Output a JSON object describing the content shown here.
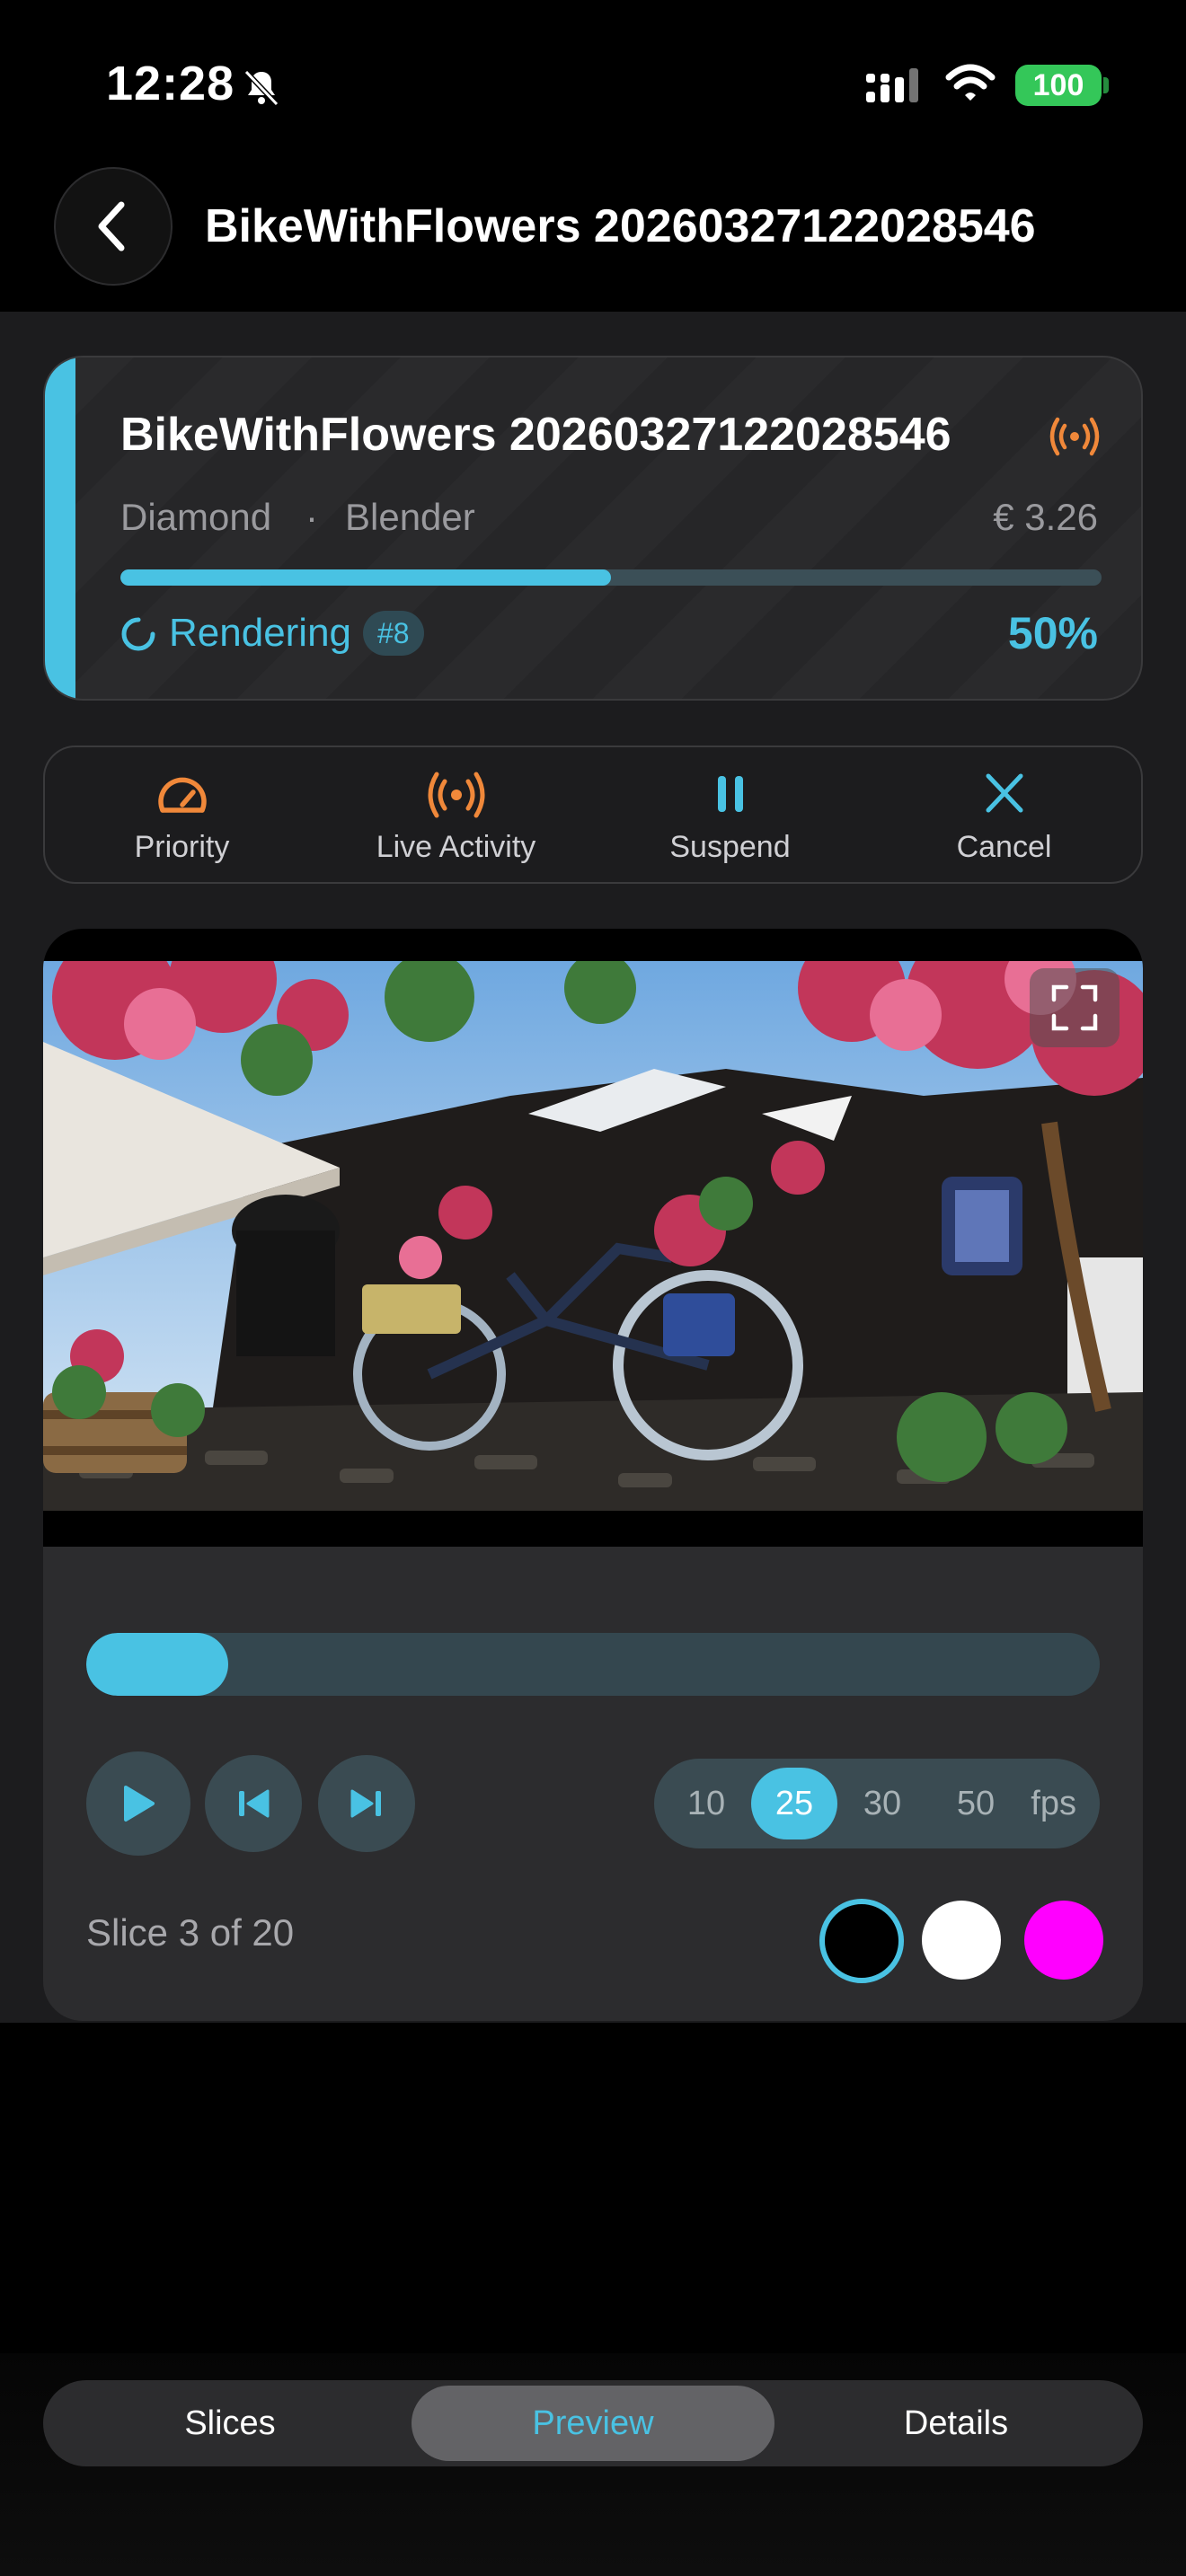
{
  "status_bar": {
    "time": "12:28",
    "battery": "100"
  },
  "header": {
    "title": "BikeWithFlowers 20260327122028546"
  },
  "job": {
    "title": "BikeWithFlowers 20260327122028546",
    "tier": "Diamond",
    "separator": "·",
    "engine": "Blender",
    "price": "€ 3.26",
    "progress": 0.5,
    "status": "Rendering",
    "badge": "#8",
    "percent": "50%"
  },
  "actions": {
    "priority": "Priority",
    "live_activity": "Live Activity",
    "suspend": "Suspend",
    "cancel": "Cancel"
  },
  "preview": {
    "slice_progress": 0.14,
    "fps_options": [
      "10",
      "25",
      "30",
      "50"
    ],
    "fps_selected": "25",
    "fps_unit": "fps",
    "slice_counter": "Slice 3 of 20",
    "background_swatches": [
      "#000000",
      "#ffffff",
      "#ff00ff"
    ],
    "selected_swatch": "#000000"
  },
  "tabs": {
    "slices": "Slices",
    "preview": "Preview",
    "details": "Details",
    "active": "Preview"
  },
  "colors": {
    "accent": "#49c2e3",
    "orange": "#f0883a",
    "background": "#000000"
  }
}
